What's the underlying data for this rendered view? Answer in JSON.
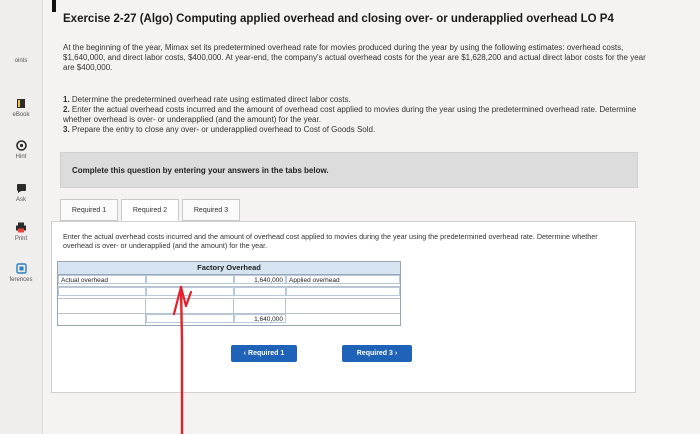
{
  "sidebar": {
    "items": [
      {
        "label": "oints",
        "icon": "points-icon"
      },
      {
        "label": "eBook",
        "icon": "book-icon"
      },
      {
        "label": "Hint",
        "icon": "hint-icon"
      },
      {
        "label": "Ask",
        "icon": "ask-icon"
      },
      {
        "label": "Print",
        "icon": "print-icon"
      },
      {
        "label": "ferences",
        "icon": "references-icon"
      }
    ]
  },
  "header": {
    "title": "Exercise 2-27 (Algo) Computing applied overhead and closing over- or underapplied overhead LO P4"
  },
  "intro": "At the beginning of the year, Mimax set its predetermined overhead rate for movies produced during the year by using the following estimates: overhead costs, $1,640,000, and direct labor costs, $400,000. At year-end, the company's actual overhead costs for the year are $1,628,200 and actual direct labor costs for the year are $400,000.",
  "requirements": [
    {
      "num": "1.",
      "text": "Determine the predetermined overhead rate using estimated direct labor costs."
    },
    {
      "num": "2.",
      "text": "Enter the actual overhead costs incurred and the amount of overhead cost applied to movies during the year using the predetermined overhead rate. Determine whether overhead is over- or underapplied (and the amount) for the year."
    },
    {
      "num": "3.",
      "text": "Prepare the entry to close any over- or underapplied overhead to Cost of Goods Sold."
    }
  ],
  "banner": "Complete this question by entering your answers in the tabs below.",
  "tabs": [
    {
      "label": "Required 1"
    },
    {
      "label": "Required 2"
    },
    {
      "label": "Required 3"
    }
  ],
  "panel": {
    "instruction": "Enter the actual overhead costs incurred and the amount of overhead cost applied to movies during the year using the predetermined overhead rate. Determine whether overhead is over- or underapplied (and the amount) for the year.",
    "t_account": {
      "title": "Factory Overhead",
      "row1": {
        "left_label": "Actual overhead",
        "left_value": "",
        "right_value": "1,640,000",
        "right_label": "Applied overhead"
      },
      "row2": {
        "left_label": "",
        "left_value": "",
        "right_value": "",
        "right_label": ""
      },
      "row3": {
        "left_label": "",
        "left_value": "",
        "right_value": "1,640,000",
        "right_label": ""
      }
    },
    "prev_button": "Required 1",
    "next_button": "Required 3",
    "prev_icon": "chevron-left-icon",
    "next_icon": "chevron-right-icon"
  },
  "colors": {
    "accent": "#1e63b8",
    "header_fill": "#d6e4f2",
    "annotation": "#e5202b"
  }
}
